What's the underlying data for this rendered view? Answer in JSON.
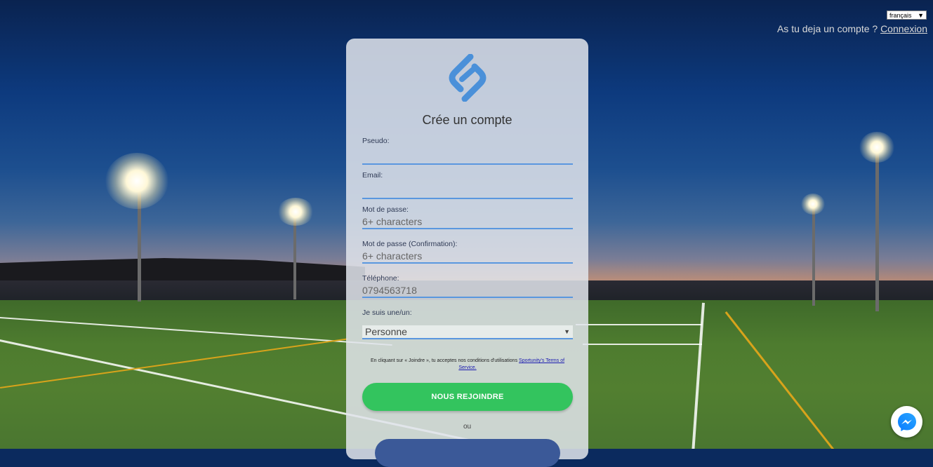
{
  "top": {
    "language": "français",
    "account_question": "As tu deja un compte ?",
    "login_link": "Connexion"
  },
  "form": {
    "title": "Crée un compte",
    "fields": [
      {
        "label": "Pseudo:",
        "placeholder": ""
      },
      {
        "label": "Email:",
        "placeholder": ""
      },
      {
        "label": "Mot de passe:",
        "placeholder": "6+ characters"
      },
      {
        "label": "Mot de passe (Confirmation):",
        "placeholder": "6+ characters"
      },
      {
        "label": "Téléphone:",
        "placeholder": "0794563718"
      }
    ],
    "role_label": "Je suis une/un:",
    "role_value": "Personne",
    "terms_text": "En cliquant sur « Joindre », tu acceptes nos conditions d'utilisations",
    "terms_link": "Sportunity's Terms of Service.",
    "join_button": "NOUS REJOINDRE",
    "or_text": "ou"
  },
  "colors": {
    "accent": "#5a97df",
    "join": "#33c45e",
    "facebook": "#3b5998",
    "logo": "#4a90d9"
  },
  "icons": {
    "logo": "sportunity-logo-icon",
    "messenger": "messenger-icon",
    "dropdown": "caret-down-icon"
  }
}
